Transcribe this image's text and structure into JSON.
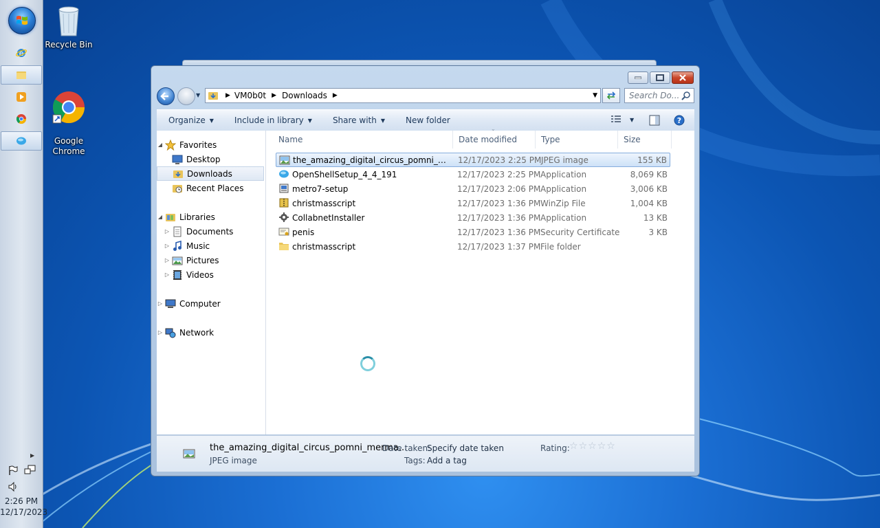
{
  "desktop": {
    "icons": [
      {
        "label": "Recycle Bin"
      },
      {
        "label": "Google\nChrome"
      }
    ]
  },
  "taskbar": {
    "time": "2:26 PM",
    "date": "12/17/2023"
  },
  "window": {
    "address": {
      "segments": [
        "VM0b0t",
        "Downloads"
      ]
    },
    "search_placeholder": "Search Do...",
    "toolbar": {
      "organize": "Organize",
      "include_in_library": "Include in library",
      "share_with": "Share with",
      "new_folder": "New folder"
    },
    "nav": {
      "favorites": "Favorites",
      "desktop": "Desktop",
      "downloads": "Downloads",
      "recent_places": "Recent Places",
      "libraries": "Libraries",
      "documents": "Documents",
      "music": "Music",
      "pictures": "Pictures",
      "videos": "Videos",
      "computer": "Computer",
      "network": "Network"
    },
    "columns": {
      "name": "Name",
      "date_modified": "Date modified",
      "type": "Type",
      "size": "Size"
    },
    "files": [
      {
        "name": "the_amazing_digital_circus_pomni_mer...",
        "date": "12/17/2023 2:25 PM",
        "type": "JPEG image",
        "size": "155 KB",
        "icon": "image-file-icon"
      },
      {
        "name": "OpenShellSetup_4_4_191",
        "date": "12/17/2023 2:25 PM",
        "type": "Application",
        "size": "8,069 KB",
        "icon": "openshell-icon"
      },
      {
        "name": "metro7-setup",
        "date": "12/17/2023 2:06 PM",
        "type": "Application",
        "size": "3,006 KB",
        "icon": "installer-icon"
      },
      {
        "name": "christmasscript",
        "date": "12/17/2023 1:36 PM",
        "type": "WinZip File",
        "size": "1,004 KB",
        "icon": "zip-file-icon"
      },
      {
        "name": "CollabnetInstaller",
        "date": "12/17/2023 1:36 PM",
        "type": "Application",
        "size": "13 KB",
        "icon": "app-gear-icon"
      },
      {
        "name": "penis",
        "date": "12/17/2023 1:36 PM",
        "type": "Security Certificate",
        "size": "3 KB",
        "icon": "certificate-icon"
      },
      {
        "name": "christmasscript",
        "date": "12/17/2023 1:37 PM",
        "type": "File folder",
        "size": "",
        "icon": "folder-icon"
      }
    ],
    "details": {
      "filename": "the_amazing_digital_circus_pomni_merma...",
      "filetype": "JPEG image",
      "date_taken_label": "Date taken:",
      "date_taken_value": "Specify date taken",
      "tags_label": "Tags:",
      "tags_value": "Add a tag",
      "rating_label": "Rating:"
    }
  }
}
